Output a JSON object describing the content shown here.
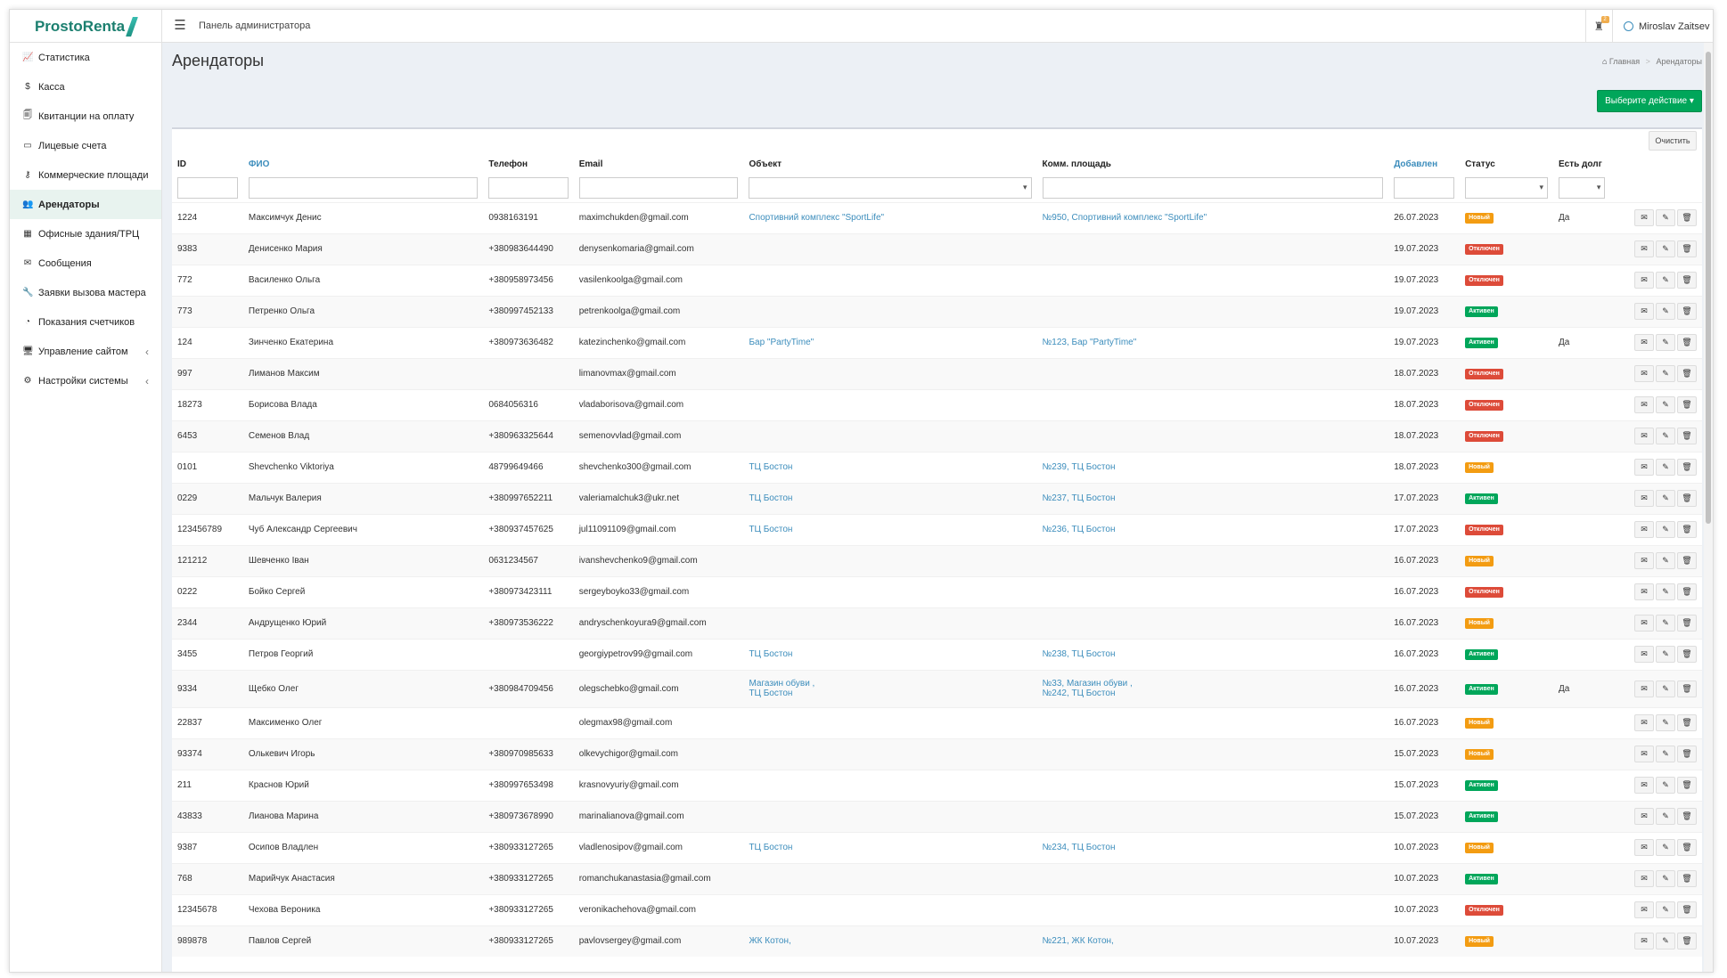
{
  "app": {
    "logo_text": "ProstoRenta",
    "panel_title": "Панель администратора",
    "user_name": "Miroslav Zaitsev",
    "notif_count": "2"
  },
  "sidebar": {
    "items": [
      {
        "label": "Статистика",
        "icon": "chart-line-icon",
        "glyph": "📈"
      },
      {
        "label": "Касса",
        "icon": "dollar-icon",
        "glyph": "$"
      },
      {
        "label": "Квитанции на оплату",
        "icon": "receipt-icon",
        "glyph": "🗐"
      },
      {
        "label": "Лицевые счета",
        "icon": "card-icon",
        "glyph": "▭"
      },
      {
        "label": "Коммерческие площади",
        "icon": "key-icon",
        "glyph": "⚷"
      },
      {
        "label": "Арендаторы",
        "icon": "users-icon",
        "glyph": "👥",
        "active": true
      },
      {
        "label": "Офисные здания/ТРЦ",
        "icon": "building-icon",
        "glyph": "▦"
      },
      {
        "label": "Сообщения",
        "icon": "envelope-icon",
        "glyph": "✉"
      },
      {
        "label": "Заявки вызова мастера",
        "icon": "wrench-icon",
        "glyph": "🔧"
      },
      {
        "label": "Показания счетчиков",
        "icon": "gauge-icon",
        "glyph": "◔"
      },
      {
        "label": "Управление сайтом",
        "icon": "monitor-icon",
        "glyph": "🖥",
        "chevron": "‹"
      },
      {
        "label": "Настройки системы",
        "icon": "cogs-icon",
        "glyph": "⚙",
        "chevron": "‹"
      }
    ]
  },
  "page": {
    "title": "Арендаторы",
    "breadcrumb_home": "Главная",
    "breadcrumb_current": "Арендаторы",
    "action_button": "Выберите действие ▾",
    "clear_button": "Очистить"
  },
  "table": {
    "headers": {
      "id": "ID",
      "fio": "ФИО",
      "phone": "Телефон",
      "email": "Email",
      "object": "Объект",
      "area": "Комм. площадь",
      "added": "Добавлен",
      "status": "Статус",
      "debt": "Есть долг"
    },
    "rows": [
      {
        "id": "1224",
        "fio": "Максимчук Денис",
        "phone": "0938163191",
        "email": "maximchukden@gmail.com",
        "object": "Спортивний комплекс \"SportLife\"",
        "object2": "",
        "area": "№950, Спортивний комплекс \"SportLife\"",
        "area2": "",
        "added": "26.07.2023",
        "status": "Новый",
        "st": "new",
        "debt": "Да"
      },
      {
        "id": "9383",
        "fio": "Денисенко Мария",
        "phone": "+380983644490",
        "email": "denysenkomaria@gmail.com",
        "object": "",
        "object2": "",
        "area": "",
        "area2": "",
        "added": "19.07.2023",
        "status": "Отключен",
        "st": "off",
        "debt": ""
      },
      {
        "id": "772",
        "fio": "Василенко Ольга",
        "phone": "+380958973456",
        "email": "vasilenkoolga@gmail.com",
        "object": "",
        "object2": "",
        "area": "",
        "area2": "",
        "added": "19.07.2023",
        "status": "Отключен",
        "st": "off",
        "debt": ""
      },
      {
        "id": "773",
        "fio": "Петренко Ольга",
        "phone": "+380997452133",
        "email": "petrenkoolga@gmail.com",
        "object": "",
        "object2": "",
        "area": "",
        "area2": "",
        "added": "19.07.2023",
        "status": "Активен",
        "st": "act",
        "debt": ""
      },
      {
        "id": "124",
        "fio": "Зинченко Екатерина",
        "phone": "+380973636482",
        "email": "katezinchenko@gmail.com",
        "object": "Бар \"PartyTime\"",
        "object2": "",
        "area": "№123, Бар \"PartyTime\"",
        "area2": "",
        "added": "19.07.2023",
        "status": "Активен",
        "st": "act",
        "debt": "Да"
      },
      {
        "id": "997",
        "fio": "Лиманов Максим",
        "phone": "",
        "email": "limanovmax@gmail.com",
        "object": "",
        "object2": "",
        "area": "",
        "area2": "",
        "added": "18.07.2023",
        "status": "Отключен",
        "st": "off",
        "debt": ""
      },
      {
        "id": "18273",
        "fio": "Борисова Влада",
        "phone": "0684056316",
        "email": "vladaborisova@gmail.com",
        "object": "",
        "object2": "",
        "area": "",
        "area2": "",
        "added": "18.07.2023",
        "status": "Отключен",
        "st": "off",
        "debt": ""
      },
      {
        "id": "6453",
        "fio": "Семенов Влад",
        "phone": "+380963325644",
        "email": "semenovvlad@gmail.com",
        "object": "",
        "object2": "",
        "area": "",
        "area2": "",
        "added": "18.07.2023",
        "status": "Отключен",
        "st": "off",
        "debt": ""
      },
      {
        "id": "0101",
        "fio": "Shevchenko Viktoriya",
        "phone": "48799649466",
        "email": "shevchenko300@gmail.com",
        "object": "ТЦ Бостон",
        "object2": "",
        "area": "№239, ТЦ Бостон",
        "area2": "",
        "added": "18.07.2023",
        "status": "Новый",
        "st": "new",
        "debt": ""
      },
      {
        "id": "0229",
        "fio": "Мальчук Валерия",
        "phone": "+380997652211",
        "email": "valeriamalchuk3@ukr.net",
        "object": "ТЦ Бостон",
        "object2": "",
        "area": "№237, ТЦ Бостон",
        "area2": "",
        "added": "17.07.2023",
        "status": "Активен",
        "st": "act",
        "debt": ""
      },
      {
        "id": "123456789",
        "fio": "Чуб Александр Сергеевич",
        "phone": "+380937457625",
        "email": "jul11091109@gmail.com",
        "object": "ТЦ Бостон",
        "object2": "",
        "area": "№236, ТЦ Бостон",
        "area2": "",
        "added": "17.07.2023",
        "status": "Отключен",
        "st": "off",
        "debt": ""
      },
      {
        "id": "121212",
        "fio": "Шевченко Іван",
        "phone": "0631234567",
        "email": "ivanshevchenko9@gmail.com",
        "object": "",
        "object2": "",
        "area": "",
        "area2": "",
        "added": "16.07.2023",
        "status": "Новый",
        "st": "new",
        "debt": ""
      },
      {
        "id": "0222",
        "fio": "Бойко Сергей",
        "phone": "+380973423111",
        "email": "sergeyboyko33@gmail.com",
        "object": "",
        "object2": "",
        "area": "",
        "area2": "",
        "added": "16.07.2023",
        "status": "Отключен",
        "st": "off",
        "debt": ""
      },
      {
        "id": "2344",
        "fio": "Андрущенко Юрий",
        "phone": "+380973536222",
        "email": "andryschenkoyura9@gmail.com",
        "object": "",
        "object2": "",
        "area": "",
        "area2": "",
        "added": "16.07.2023",
        "status": "Новый",
        "st": "new",
        "debt": ""
      },
      {
        "id": "3455",
        "fio": "Петров Георгий",
        "phone": "",
        "email": "georgiypetrov99@gmail.com",
        "object": "ТЦ Бостон",
        "object2": "",
        "area": "№238, ТЦ Бостон",
        "area2": "",
        "added": "16.07.2023",
        "status": "Активен",
        "st": "act",
        "debt": ""
      },
      {
        "id": "9334",
        "fio": "Щебко Олег",
        "phone": "+380984709456",
        "email": "olegschebko@gmail.com",
        "object": "Магазин обуви ,",
        "object2": "ТЦ Бостон",
        "area": "№33, Магазин обуви ,",
        "area2": "№242, ТЦ Бостон",
        "added": "16.07.2023",
        "status": "Активен",
        "st": "act",
        "debt": "Да"
      },
      {
        "id": "22837",
        "fio": "Максименко Олег",
        "phone": "",
        "email": "olegmax98@gmail.com",
        "object": "",
        "object2": "",
        "area": "",
        "area2": "",
        "added": "16.07.2023",
        "status": "Новый",
        "st": "new",
        "debt": ""
      },
      {
        "id": "93374",
        "fio": "Олькевич Игорь",
        "phone": "+380970985633",
        "email": "olkevychigor@gmail.com",
        "object": "",
        "object2": "",
        "area": "",
        "area2": "",
        "added": "15.07.2023",
        "status": "Новый",
        "st": "new",
        "debt": ""
      },
      {
        "id": "211",
        "fio": "Краснов Юрий",
        "phone": "+380997653498",
        "email": "krasnovyuriy@gmail.com",
        "object": "",
        "object2": "",
        "area": "",
        "area2": "",
        "added": "15.07.2023",
        "status": "Активен",
        "st": "act",
        "debt": ""
      },
      {
        "id": "43833",
        "fio": "Лианова Марина",
        "phone": "+380973678990",
        "email": "marinalianova@gmail.com",
        "object": "",
        "object2": "",
        "area": "",
        "area2": "",
        "added": "15.07.2023",
        "status": "Активен",
        "st": "act",
        "debt": ""
      },
      {
        "id": "9387",
        "fio": "Осипов Владлен",
        "phone": "+380933127265",
        "email": "vladlenosipov@gmail.com",
        "object": "ТЦ Бостон",
        "object2": "",
        "area": "№234, ТЦ Бостон",
        "area2": "",
        "added": "10.07.2023",
        "status": "Новый",
        "st": "new",
        "debt": ""
      },
      {
        "id": "768",
        "fio": "Марийчук Анастасия",
        "phone": "+380933127265",
        "email": "romanchukanastasia@gmail.com",
        "object": "",
        "object2": "",
        "area": "",
        "area2": "",
        "added": "10.07.2023",
        "status": "Активен",
        "st": "act",
        "debt": ""
      },
      {
        "id": "12345678",
        "fio": "Чехова Вероника",
        "phone": "+380933127265",
        "email": "veronikachehova@gmail.com",
        "object": "",
        "object2": "",
        "area": "",
        "area2": "",
        "added": "10.07.2023",
        "status": "Отключен",
        "st": "off",
        "debt": ""
      },
      {
        "id": "989878",
        "fio": "Павлов Сергей",
        "phone": "+380933127265",
        "email": "pavlovsergey@gmail.com",
        "object": "ЖК Котон,",
        "object2": "",
        "area": "№221, ЖК Котон,",
        "area2": "",
        "added": "10.07.2023",
        "status": "Новый",
        "st": "new",
        "debt": ""
      }
    ]
  },
  "colors": {
    "accent": "#3c8dbc",
    "brand": "#1b7f6f",
    "success": "#00a65a",
    "warning": "#f39c12",
    "danger": "#dd4b39"
  }
}
